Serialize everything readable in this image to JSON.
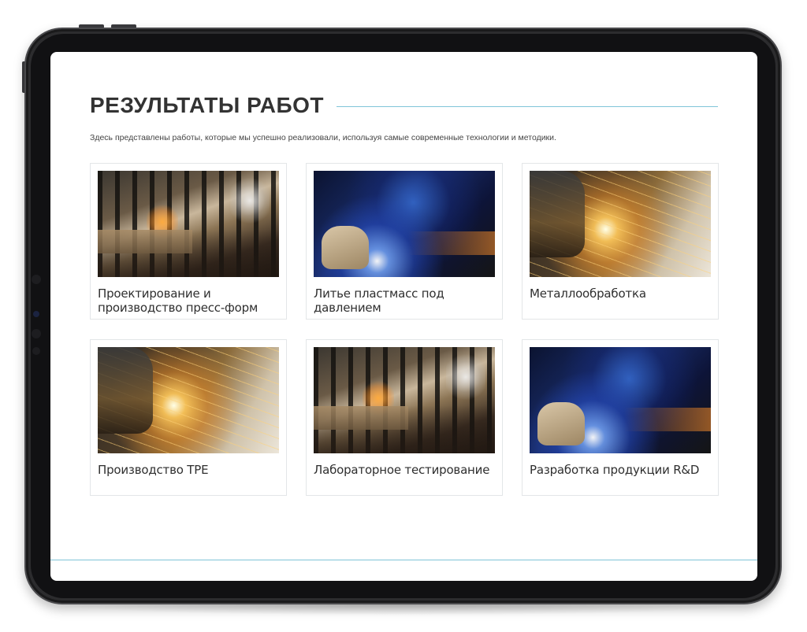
{
  "section": {
    "title": "РЕЗУЛЬТАТЫ РАБОТ",
    "intro": "Здесь представлены работы, которые мы успешно реализовали, используя самые современные технологии и методики."
  },
  "cards": [
    {
      "title": "Проектирование и производство пресс-форм",
      "image": "factory-interior-photo"
    },
    {
      "title": "Литье пластмасс под давлением",
      "image": "welding-photo"
    },
    {
      "title": "Металлообработка",
      "image": "grinding-sparks-photo"
    },
    {
      "title": "Производство TPE",
      "image": "grinding-sparks-photo"
    },
    {
      "title": "Лабораторное тестирование",
      "image": "factory-interior-photo"
    },
    {
      "title": "Разработка продукции R&D",
      "image": "welding-photo"
    }
  ],
  "colors": {
    "accent_line": "#7fc4d8",
    "title_text": "#333333",
    "card_border": "#e3e6e8",
    "device_frame": "#111113"
  }
}
